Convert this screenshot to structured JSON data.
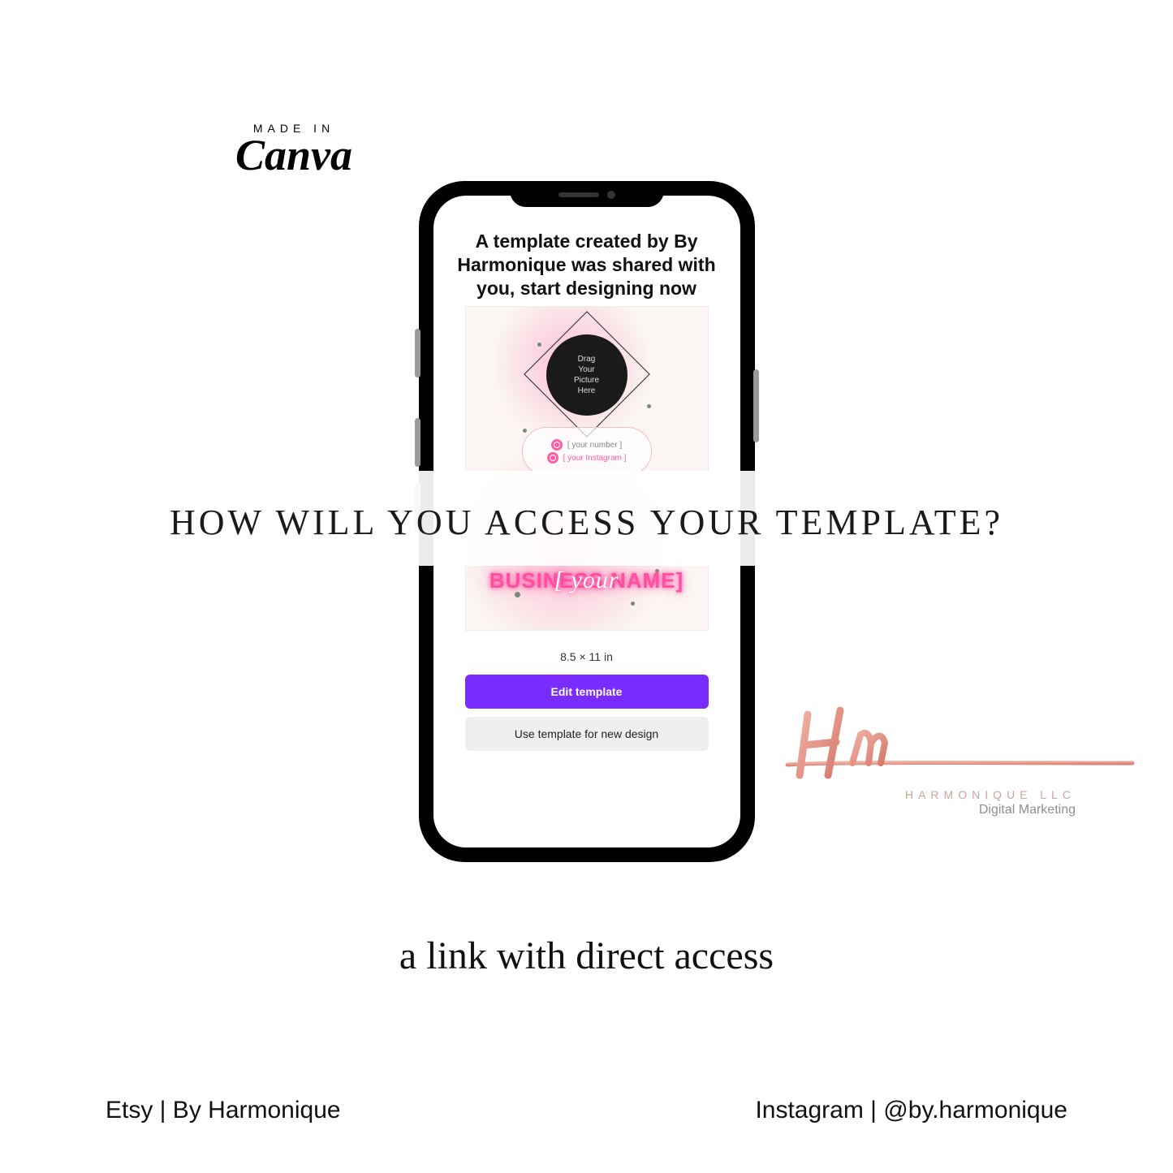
{
  "badge": {
    "overline": "MADE IN",
    "brand": "Canva"
  },
  "phone": {
    "heading": "A template created by By Harmonique was shared with you, start designing now",
    "preview": {
      "avatar_lines": [
        "Drag",
        "Your",
        "Picture",
        "Here"
      ],
      "contact_number_placeholder": "[ your number ]",
      "contact_instagram_placeholder": "[ your Instagram ]",
      "business_name_outer": "BUSINESS NAME]",
      "business_name_script": "[ your"
    },
    "dimensions": "8.5 × 11 in",
    "buttons": {
      "primary": "Edit template",
      "secondary": "Use template for new design"
    }
  },
  "headline": "HOW WILL YOU ACCESS YOUR TEMPLATE?",
  "brand_logo": {
    "company": "HARMONIQUE LLC",
    "tagline": "Digital Marketing"
  },
  "subheadline": "a link with direct access",
  "footer": {
    "left": "Etsy | By Harmonique",
    "right": "Instagram | @by.harmonique"
  },
  "colors": {
    "accent_purple": "#7a2cff",
    "accent_pink": "#ff4fa0",
    "rose_gold": "#e6988c"
  }
}
